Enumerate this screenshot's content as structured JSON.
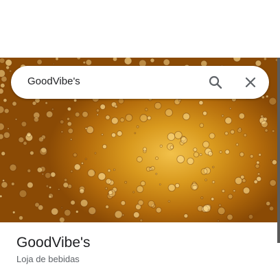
{
  "search": {
    "query": "GoodVibe's"
  },
  "place": {
    "title": "GoodVibe's",
    "category": "Loja de bebidas"
  },
  "icons": {
    "search": "search-icon",
    "close": "close-icon"
  },
  "colors": {
    "hero_amber": "#c8830f",
    "text_primary": "#202124",
    "text_secondary": "#5f6368"
  }
}
